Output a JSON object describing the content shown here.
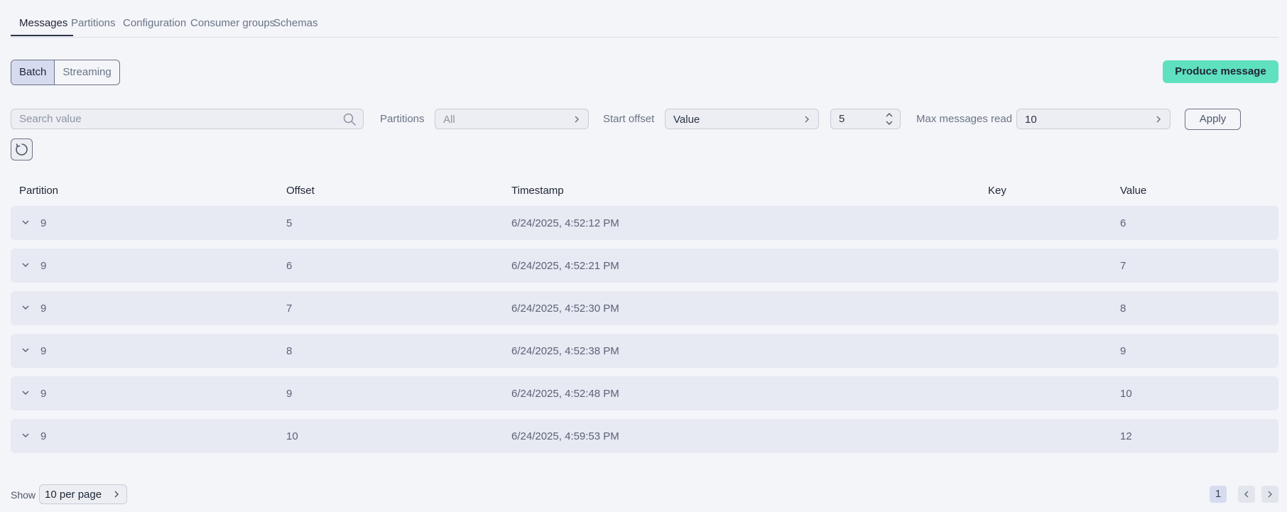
{
  "tabs": [
    {
      "label": "Messages",
      "active": true
    },
    {
      "label": "Partitions"
    },
    {
      "label": "Configuration"
    },
    {
      "label": "Consumer groups"
    },
    {
      "label": "Schemas"
    }
  ],
  "mode": {
    "batch": "Batch",
    "streaming": "Streaming",
    "selected": "Batch"
  },
  "produce_label": "Produce message",
  "filters": {
    "search_placeholder": "Search value",
    "partitions_label": "Partitions",
    "partitions_value": "All",
    "start_offset_label": "Start offset",
    "start_offset_value": "Value",
    "offset_number": "5",
    "max_label": "Max messages read",
    "max_value": "10",
    "apply_label": "Apply"
  },
  "table": {
    "columns": [
      "Partition",
      "Offset",
      "Timestamp",
      "Key",
      "Value"
    ],
    "rows": [
      {
        "partition": "9",
        "offset": "5",
        "timestamp": "6/24/2025, 4:52:12 PM",
        "key": "",
        "value": "6"
      },
      {
        "partition": "9",
        "offset": "6",
        "timestamp": "6/24/2025, 4:52:21 PM",
        "key": "",
        "value": "7"
      },
      {
        "partition": "9",
        "offset": "7",
        "timestamp": "6/24/2025, 4:52:30 PM",
        "key": "",
        "value": "8"
      },
      {
        "partition": "9",
        "offset": "8",
        "timestamp": "6/24/2025, 4:52:38 PM",
        "key": "",
        "value": "9"
      },
      {
        "partition": "9",
        "offset": "9",
        "timestamp": "6/24/2025, 4:52:48 PM",
        "key": "",
        "value": "10"
      },
      {
        "partition": "9",
        "offset": "10",
        "timestamp": "6/24/2025, 4:59:53 PM",
        "key": "",
        "value": "12"
      }
    ]
  },
  "footer": {
    "show_label": "Show",
    "per_page": "10 per page",
    "current_page": "1"
  },
  "colors": {
    "background": "#f3f5f9",
    "accent": "#5fe0be",
    "row_background": "#e7e9f3",
    "selected": "#d6dbf0"
  },
  "icons": [
    "search-icon",
    "chevron-right-icon",
    "chevron-up-icon",
    "chevron-down-icon",
    "refresh-icon",
    "chevron-left-icon"
  ]
}
